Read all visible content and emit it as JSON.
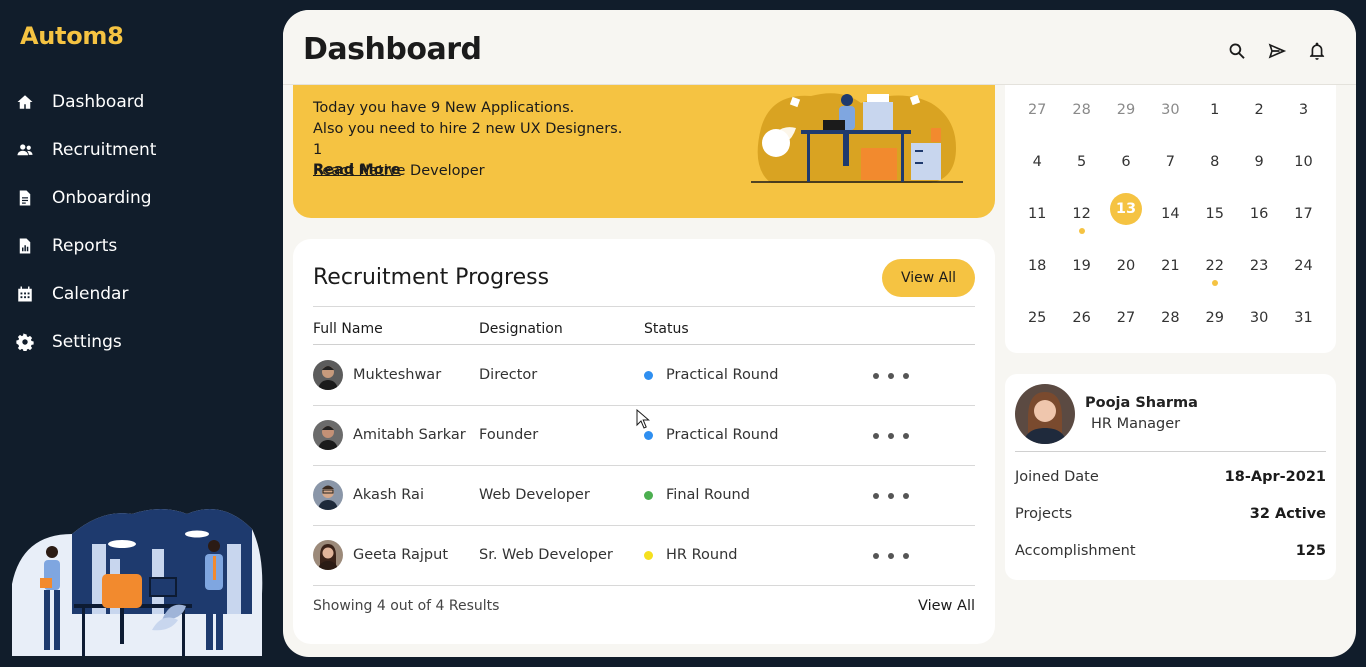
{
  "app": {
    "logo": "Autom8"
  },
  "sidebar": {
    "items": [
      {
        "label": "Dashboard",
        "icon": "home-icon"
      },
      {
        "label": "Recruitment",
        "icon": "users-icon"
      },
      {
        "label": "Onboarding",
        "icon": "document-icon"
      },
      {
        "label": "Reports",
        "icon": "report-icon"
      },
      {
        "label": "Calendar",
        "icon": "calendar-icon"
      },
      {
        "label": "Settings",
        "icon": "gear-icon"
      }
    ]
  },
  "header": {
    "title": "Dashboard",
    "icons": [
      "search-icon",
      "send-icon",
      "bell-icon"
    ]
  },
  "banner": {
    "line1": "Today you have 9 New Applications.",
    "line2": "Also you need to hire 2 new UX Designers. 1",
    "line3": "React Native Developer",
    "link": "Read More"
  },
  "recruitment": {
    "title": "Recruitment Progress",
    "view_all_button": "View All",
    "columns": [
      "Full Name",
      "Designation",
      "Status"
    ],
    "rows": [
      {
        "name": "Mukteshwar",
        "designation": "Director",
        "status": "Practical Round",
        "status_color": "#2f8ff0"
      },
      {
        "name": "Amitabh Sarkar",
        "designation": "Founder",
        "status": "Practical Round",
        "status_color": "#2f8ff0"
      },
      {
        "name": "Akash Rai",
        "designation": "Web Developer",
        "status": "Final Round",
        "status_color": "#4caf50"
      },
      {
        "name": "Geeta Rajput",
        "designation": "Sr. Web Developer",
        "status": "HR Round",
        "status_color": "#f5e01f"
      }
    ],
    "footer_text": "Showing 4 out of 4 Results",
    "footer_link": "View All"
  },
  "calendar": {
    "weeks": [
      [
        {
          "d": "27",
          "m": true
        },
        {
          "d": "28",
          "m": true
        },
        {
          "d": "29",
          "m": true
        },
        {
          "d": "30",
          "m": true
        },
        {
          "d": "1"
        },
        {
          "d": "2"
        },
        {
          "d": "3"
        }
      ],
      [
        {
          "d": "4"
        },
        {
          "d": "5"
        },
        {
          "d": "6"
        },
        {
          "d": "7"
        },
        {
          "d": "8"
        },
        {
          "d": "9"
        },
        {
          "d": "10"
        }
      ],
      [
        {
          "d": "11"
        },
        {
          "d": "12",
          "event": true
        },
        {
          "d": "13",
          "today": true
        },
        {
          "d": "14"
        },
        {
          "d": "15"
        },
        {
          "d": "16"
        },
        {
          "d": "17"
        }
      ],
      [
        {
          "d": "18"
        },
        {
          "d": "19"
        },
        {
          "d": "20"
        },
        {
          "d": "21"
        },
        {
          "d": "22",
          "event": true
        },
        {
          "d": "23"
        },
        {
          "d": "24"
        }
      ],
      [
        {
          "d": "25"
        },
        {
          "d": "26"
        },
        {
          "d": "27"
        },
        {
          "d": "28"
        },
        {
          "d": "29"
        },
        {
          "d": "30"
        },
        {
          "d": "31"
        }
      ]
    ]
  },
  "profile": {
    "name": "Pooja Sharma",
    "role": "HR Manager",
    "joined_label": "Joined Date",
    "joined_value": "18-Apr-2021",
    "projects_label": "Projects",
    "projects_value": "32 Active",
    "accomplishment_label": "Accomplishment",
    "accomplishment_value": "125"
  },
  "colors": {
    "accent": "#f5c342",
    "sidebar_bg": "#111d2b",
    "panel_bg": "#f7f6f2"
  }
}
